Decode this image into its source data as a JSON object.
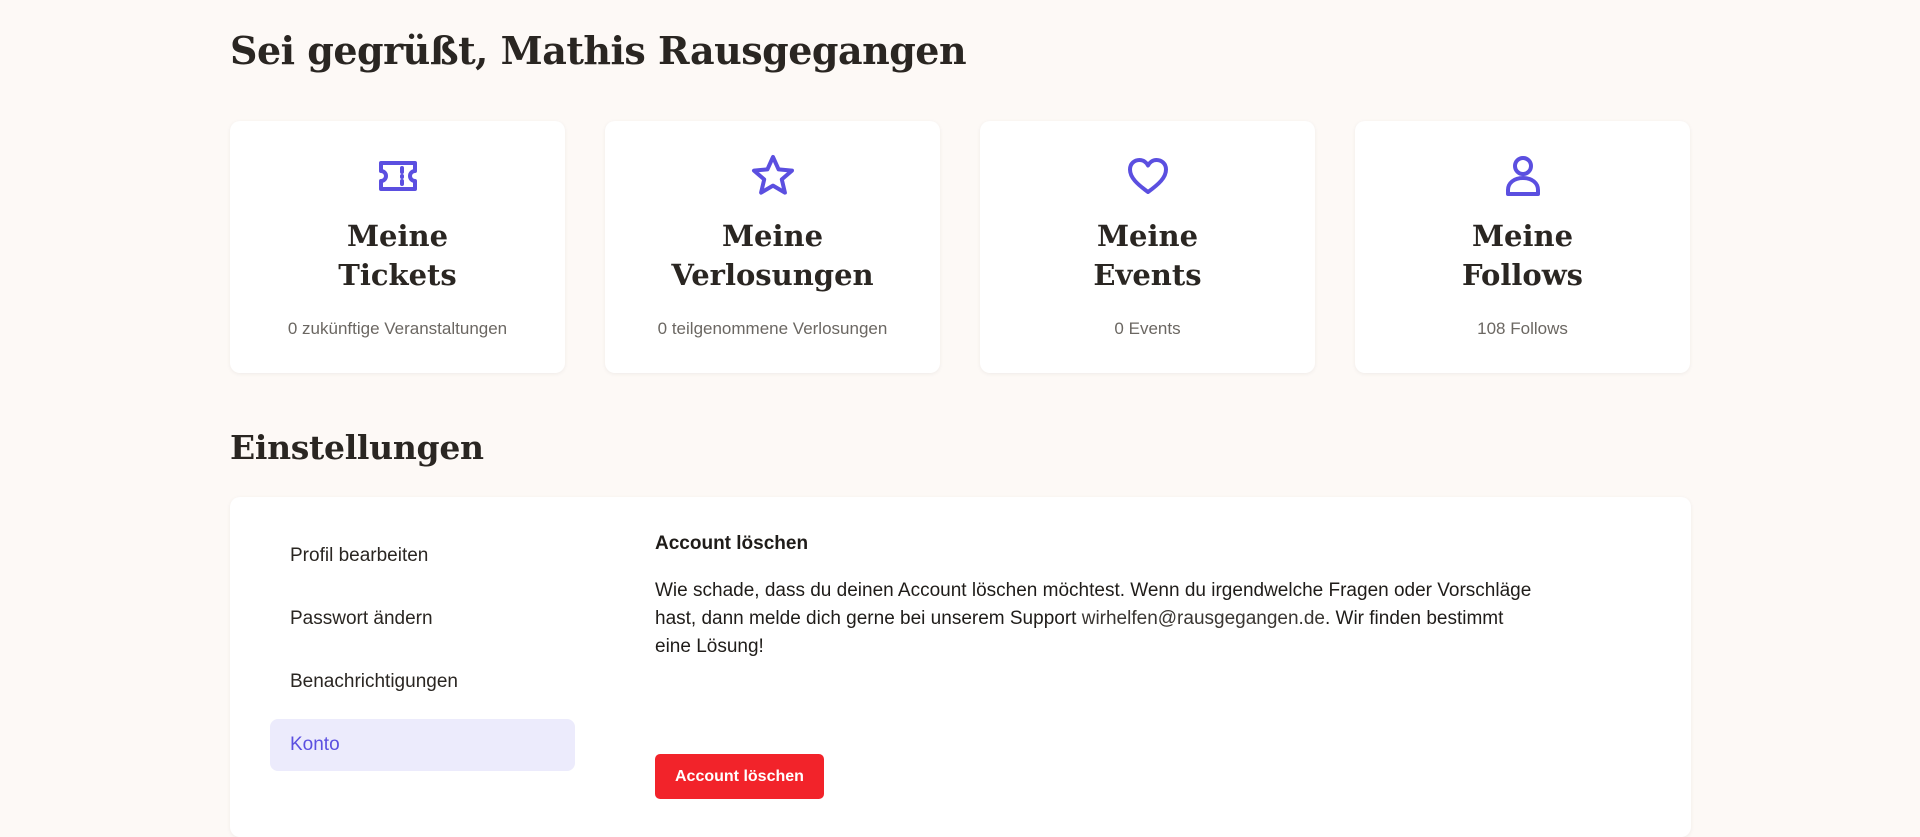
{
  "greeting": "Sei gegrüßt, Mathis Rausgegangen",
  "accent_color": "#5b4fe0",
  "cards": [
    {
      "icon": "ticket-icon",
      "title_line1": "Meine",
      "title_line2": "Tickets",
      "subtitle": "0 zukünftige Veranstaltungen"
    },
    {
      "icon": "star-icon",
      "title_line1": "Meine",
      "title_line2": "Verlosungen",
      "subtitle": "0 teilgenommene Verlosungen"
    },
    {
      "icon": "heart-icon",
      "title_line1": "Meine",
      "title_line2": "Events",
      "subtitle": "0 Events"
    },
    {
      "icon": "user-icon",
      "title_line1": "Meine",
      "title_line2": "Follows",
      "subtitle": "108 Follows"
    }
  ],
  "settings": {
    "title": "Einstellungen",
    "nav": [
      {
        "label": "Profil bearbeiten",
        "active": false
      },
      {
        "label": "Passwort ändern",
        "active": false
      },
      {
        "label": "Benachrichtigungen",
        "active": false
      },
      {
        "label": "Konto",
        "active": true
      }
    ],
    "content": {
      "heading": "Account löschen",
      "text_before_link": "Wie schade, dass du deinen Account löschen möchtest. Wenn du irgendwelche Fragen oder Vorschläge hast, dann melde dich gerne bei unserem Support ",
      "support_email": "wirhelfen@rausgegangen.de",
      "text_after_link": ". Wir finden bestimmt eine Lösung!",
      "delete_button_label": "Account löschen",
      "delete_button_color": "#f2232a"
    }
  }
}
